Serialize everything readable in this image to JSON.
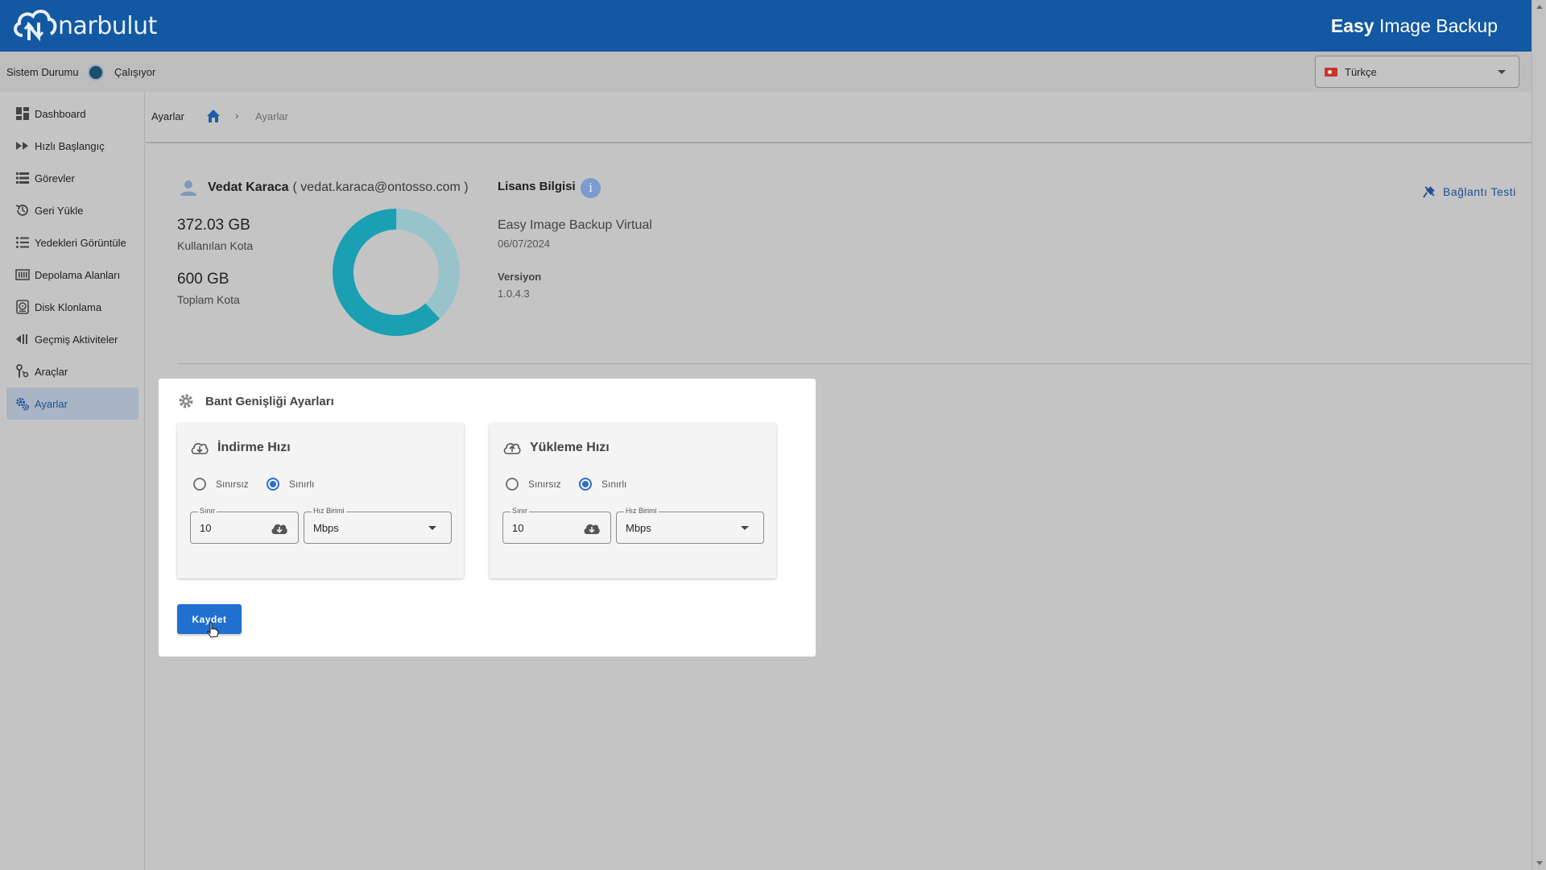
{
  "header": {
    "logo_text": "narbulut",
    "app_title_bold": "Easy",
    "app_title_rest": " Image Backup"
  },
  "status": {
    "label": "Sistem Durumu",
    "value": "Çalışıyor"
  },
  "language": {
    "selected": "Türkçe"
  },
  "sidebar": {
    "items": [
      {
        "label": "Dashboard"
      },
      {
        "label": "Hızlı Başlangıç"
      },
      {
        "label": "Görevler"
      },
      {
        "label": "Geri Yükle"
      },
      {
        "label": "Yedekleri Görüntüle"
      },
      {
        "label": "Depolama Alanları"
      },
      {
        "label": "Disk Klonlama"
      },
      {
        "label": "Geçmiş Aktiviteler"
      },
      {
        "label": "Araçlar"
      },
      {
        "label": "Ayarlar"
      }
    ]
  },
  "breadcrumb": {
    "title": "Ayarlar",
    "separator": "›",
    "current": "Ayarlar"
  },
  "account": {
    "name": "Vedat Karaca",
    "email": "( vedat.karaca@ontosso.com )",
    "used_quota": "372.03 GB",
    "used_quota_label": "Kullanılan Kota",
    "total_quota": "600 GB",
    "total_quota_label": "Toplam Kota",
    "used_fraction": 0.62
  },
  "license": {
    "title": "Lisans Bilgisi",
    "info_glyph": "i",
    "product": "Easy Image Backup Virtual",
    "date": "06/07/2024",
    "version_label": "Versiyon",
    "version_value": "1.0.4.3"
  },
  "connection_test": {
    "label": "Bağlantı Testi"
  },
  "bandwidth": {
    "title": "Bant Genişliği Ayarları",
    "download": {
      "title": "İndirme Hızı",
      "option_unlimited": "Sınırsız",
      "option_limited": "Sınırlı",
      "selected": "limited",
      "limit_label": "Sınır",
      "limit_value": "10",
      "unit_label": "Hız Birimi",
      "unit_value": "Mbps"
    },
    "upload": {
      "title": "Yükleme Hızı",
      "option_unlimited": "Sınırsız",
      "option_limited": "Sınırlı",
      "selected": "limited",
      "limit_label": "Sınır",
      "limit_value": "10",
      "unit_label": "Hız Birimi",
      "unit_value": "Mbps"
    },
    "save_label": "Kaydet"
  },
  "colors": {
    "header": "#1258a2",
    "accent": "#1f70cf",
    "donut_used": "#1a9fb3",
    "donut_free": "#98c3ca"
  }
}
